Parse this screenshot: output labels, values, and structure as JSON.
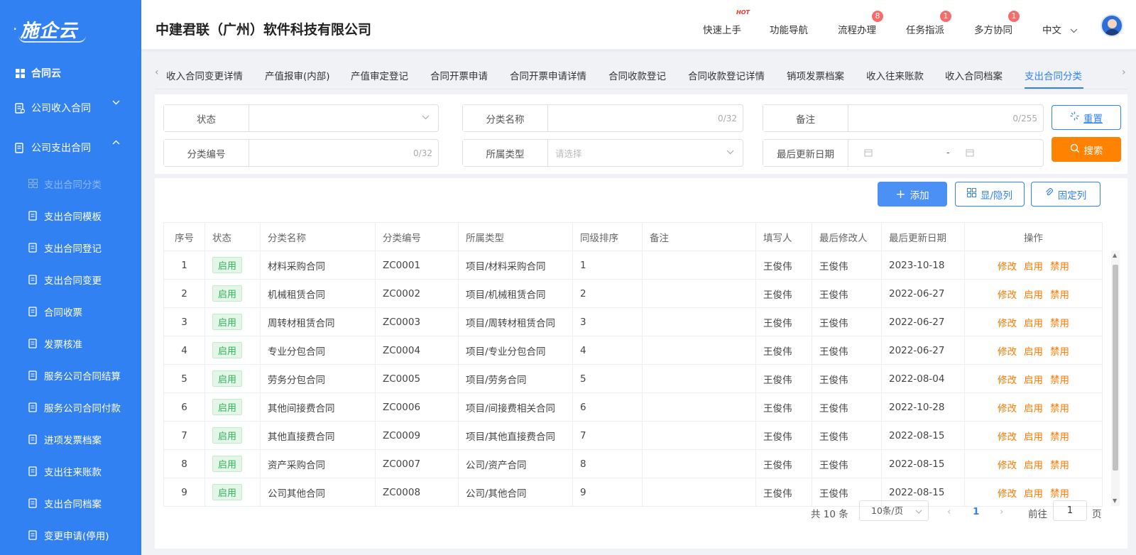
{
  "app": {
    "logo": "施企云",
    "company": "中建君联（广州）软件科技有限公司"
  },
  "header_nav": [
    {
      "label": "快速上手",
      "tag": "HOT"
    },
    {
      "label": "功能导航"
    },
    {
      "label": "流程办理",
      "badge": "8"
    },
    {
      "label": "任务指派",
      "badge": "1"
    },
    {
      "label": "多方协同",
      "badge": "1"
    },
    {
      "label": "中文"
    }
  ],
  "sidebar": {
    "top": "合同云",
    "groups": [
      {
        "label": "公司收入合同"
      },
      {
        "label": "公司支出合同"
      }
    ],
    "items": [
      {
        "label": "支出合同分类",
        "icon": "grid-icon",
        "active": true
      },
      {
        "label": "支出合同模板",
        "icon": "hierarchy-icon"
      },
      {
        "label": "支出合同登记",
        "icon": "register-icon"
      },
      {
        "label": "支出合同变更",
        "icon": "change-icon"
      },
      {
        "label": "合同收票",
        "icon": "receipt-icon"
      },
      {
        "label": "发票核准",
        "icon": "clipboard-icon"
      },
      {
        "label": "服务公司合同结算",
        "icon": "settle-icon"
      },
      {
        "label": "服务公司合同付款",
        "icon": "yen-icon"
      },
      {
        "label": "进项发票档案",
        "icon": "archive-icon"
      },
      {
        "label": "支出往来账款",
        "icon": "ledger-icon"
      },
      {
        "label": "支出合同档案",
        "icon": "file-check-icon"
      },
      {
        "label": "变更申请(停用)",
        "icon": "edit-doc-icon"
      }
    ]
  },
  "tabs": [
    {
      "label": "收入合同变更详情"
    },
    {
      "label": "产值报审(内部)"
    },
    {
      "label": "产值审定登记"
    },
    {
      "label": "合同开票申请"
    },
    {
      "label": "合同开票申请详情"
    },
    {
      "label": "合同收款登记"
    },
    {
      "label": "合同收款登记详情"
    },
    {
      "label": "销项发票档案"
    },
    {
      "label": "收入往来账款"
    },
    {
      "label": "收入合同档案"
    },
    {
      "label": "支出合同分类",
      "active": true
    }
  ],
  "filters": {
    "status": {
      "label": "状态",
      "value": ""
    },
    "category_name": {
      "label": "分类名称",
      "count": "0/32"
    },
    "remark": {
      "label": "备注",
      "count": "0/255"
    },
    "category_code": {
      "label": "分类编号",
      "count": "0/32"
    },
    "belong_type": {
      "label": "所属类型",
      "placeholder": "请选择"
    },
    "last_update": {
      "label": "最后更新日期",
      "separator": "-"
    },
    "reset_button": "重置",
    "search_button": "搜索"
  },
  "toolbar": {
    "add": "添加",
    "toggle_columns": "显/隐列",
    "fix_columns": "固定列"
  },
  "table": {
    "headers": [
      "序号",
      "状态",
      "分类名称",
      "分类编号",
      "所属类型",
      "同级排序",
      "备注",
      "填写人",
      "最后修改人",
      "最后更新日期",
      "操作"
    ],
    "actions": [
      "修改",
      "启用",
      "禁用"
    ],
    "rows": [
      {
        "no": "1",
        "status": "启用",
        "name": "材料采购合同",
        "code": "ZC0001",
        "type": "项目/材料采购合同",
        "sort": "1",
        "remark": "",
        "creator": "王俊伟",
        "modifier": "王俊伟",
        "date": "2023-10-18"
      },
      {
        "no": "2",
        "status": "启用",
        "name": "机械租赁合同",
        "code": "ZC0002",
        "type": "项目/机械租赁合同",
        "sort": "2",
        "remark": "",
        "creator": "王俊伟",
        "modifier": "王俊伟",
        "date": "2022-06-27"
      },
      {
        "no": "3",
        "status": "启用",
        "name": "周转材租赁合同",
        "code": "ZC0003",
        "type": "项目/周转材租赁合同",
        "sort": "3",
        "remark": "",
        "creator": "王俊伟",
        "modifier": "王俊伟",
        "date": "2022-06-27"
      },
      {
        "no": "4",
        "status": "启用",
        "name": "专业分包合同",
        "code": "ZC0004",
        "type": "项目/专业分包合同",
        "sort": "4",
        "remark": "",
        "creator": "王俊伟",
        "modifier": "王俊伟",
        "date": "2022-06-27"
      },
      {
        "no": "5",
        "status": "启用",
        "name": "劳务分包合同",
        "code": "ZC0005",
        "type": "项目/劳务合同",
        "sort": "5",
        "remark": "",
        "creator": "王俊伟",
        "modifier": "王俊伟",
        "date": "2022-08-04"
      },
      {
        "no": "6",
        "status": "启用",
        "name": "其他间接费合同",
        "code": "ZC0006",
        "type": "项目/间接费相关合同",
        "sort": "6",
        "remark": "",
        "creator": "王俊伟",
        "modifier": "王俊伟",
        "date": "2022-10-28"
      },
      {
        "no": "7",
        "status": "启用",
        "name": "其他直接费合同",
        "code": "ZC0009",
        "type": "项目/其他直接费合同",
        "sort": "7",
        "remark": "",
        "creator": "王俊伟",
        "modifier": "王俊伟",
        "date": "2022-08-15"
      },
      {
        "no": "8",
        "status": "启用",
        "name": "资产采购合同",
        "code": "ZC0007",
        "type": "公司/资产合同",
        "sort": "8",
        "remark": "",
        "creator": "王俊伟",
        "modifier": "王俊伟",
        "date": "2022-08-15"
      },
      {
        "no": "9",
        "status": "启用",
        "name": "公司其他合同",
        "code": "ZC0008",
        "type": "公司/其他合同",
        "sort": "9",
        "remark": "",
        "creator": "王俊伟",
        "modifier": "王俊伟",
        "date": "2022-08-15"
      }
    ]
  },
  "pagination": {
    "total": "共 10 条",
    "page_size": "10条/页",
    "current": "1",
    "goto_label": "前往",
    "goto_value": "1",
    "page_unit": "页"
  },
  "colors": {
    "sidebar": "#3281f3",
    "accent": "#3281f3",
    "search": "#ff8200",
    "action": "#ff7a00",
    "status_green": "#2eb257"
  }
}
